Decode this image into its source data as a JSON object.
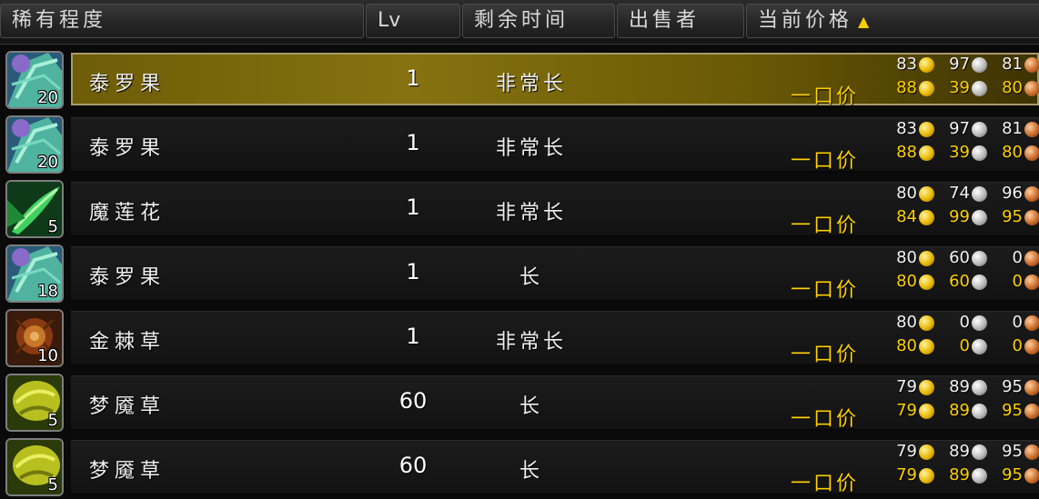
{
  "header": {
    "rarity": "稀有程度",
    "lv": "Lv",
    "time_left": "剩余时间",
    "seller": "出售者",
    "current_price": "当前价格",
    "sort_arrow": "▲"
  },
  "buyout_label": "一口价",
  "colors": {
    "gold": "#ffd000",
    "selected_bar": "#867210"
  },
  "rows": [
    {
      "name": "泰罗果",
      "stack": "20",
      "icon": "terocone-icon",
      "lv": "1",
      "time": "非常长",
      "cur": {
        "g": "83",
        "s": "97",
        "c": "81"
      },
      "buy": {
        "g": "88",
        "s": "39",
        "c": "80"
      },
      "selected": true
    },
    {
      "name": "泰罗果",
      "stack": "20",
      "icon": "terocone-icon",
      "lv": "1",
      "time": "非常长",
      "cur": {
        "g": "83",
        "s": "97",
        "c": "81"
      },
      "buy": {
        "g": "88",
        "s": "39",
        "c": "80"
      }
    },
    {
      "name": "魔莲花",
      "stack": "5",
      "icon": "mana-thistle-icon",
      "lv": "1",
      "time": "非常长",
      "cur": {
        "g": "80",
        "s": "74",
        "c": "96"
      },
      "buy": {
        "g": "84",
        "s": "99",
        "c": "95"
      }
    },
    {
      "name": "泰罗果",
      "stack": "18",
      "icon": "terocone-icon",
      "lv": "1",
      "time": "长",
      "cur": {
        "g": "80",
        "s": "60",
        "c": "0"
      },
      "buy": {
        "g": "80",
        "s": "60",
        "c": "0"
      }
    },
    {
      "name": "金棘草",
      "stack": "10",
      "icon": "goldthorn-icon",
      "lv": "1",
      "time": "非常长",
      "cur": {
        "g": "80",
        "s": "0",
        "c": "0"
      },
      "buy": {
        "g": "80",
        "s": "0",
        "c": "0"
      }
    },
    {
      "name": "梦魇草",
      "stack": "5",
      "icon": "nightmare-vine-icon",
      "lv": "60",
      "time": "长",
      "cur": {
        "g": "79",
        "s": "89",
        "c": "95"
      },
      "buy": {
        "g": "79",
        "s": "89",
        "c": "95"
      }
    },
    {
      "name": "梦魇草",
      "stack": "5",
      "icon": "nightmare-vine-icon",
      "lv": "60",
      "time": "长",
      "cur": {
        "g": "79",
        "s": "89",
        "c": "95"
      },
      "buy": {
        "g": "79",
        "s": "89",
        "c": "95"
      }
    }
  ]
}
